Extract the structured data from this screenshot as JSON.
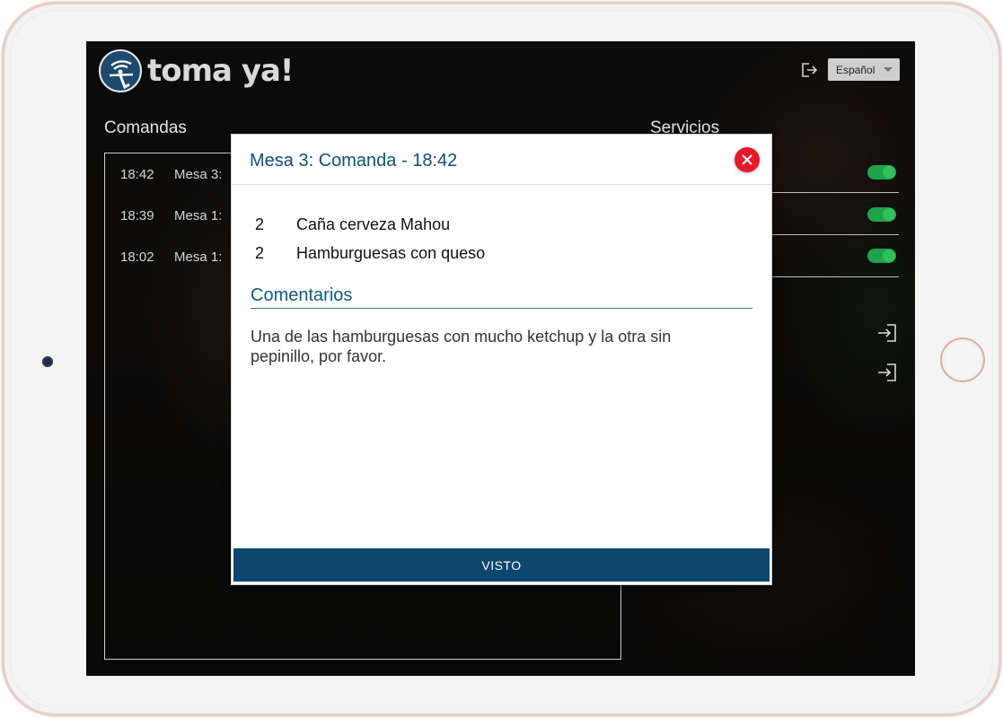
{
  "app": {
    "logo_text": "toma ya!",
    "language": "Español"
  },
  "comandas": {
    "title": "Comandas",
    "orders": [
      {
        "time": "18:42",
        "label": "Mesa 3: "
      },
      {
        "time": "18:39",
        "label": "Mesa 1: "
      },
      {
        "time": "18:02",
        "label": "Mesa 1: "
      }
    ]
  },
  "servicios": {
    "title": "Servicios",
    "toggles": [
      true,
      true,
      true
    ]
  },
  "modal": {
    "title": "Mesa 3: Comanda - 18:42",
    "items": [
      {
        "qty": "2",
        "name": "Caña cerveza Mahou"
      },
      {
        "qty": "2",
        "name": "Hamburguesas con queso"
      }
    ],
    "comments_heading": "Comentarios",
    "comments_text": "Una de las hamburguesas con mucho ketchup y la otra sin pepinillo, por favor.",
    "visto_label": "VISTO"
  },
  "colors": {
    "accent": "#0c476d",
    "title": "#0f4f78",
    "close": "#e8192c",
    "toggle_on": "#1fa34a"
  }
}
